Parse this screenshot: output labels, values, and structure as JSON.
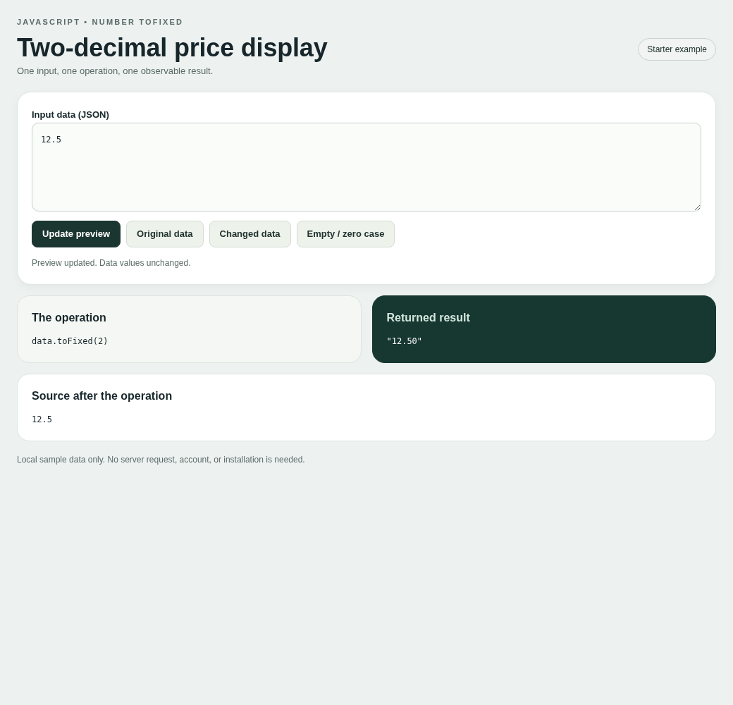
{
  "header": {
    "eyebrow": "JAVASCRIPT • NUMBER TOFIXED",
    "title": "Two-decimal price display",
    "subtitle": "One input, one operation, one observable result.",
    "badge": "Starter example"
  },
  "input_panel": {
    "label": "Input data (JSON)",
    "value": "12.5",
    "buttons": [
      {
        "label": "Update preview",
        "kind": "primary"
      },
      {
        "label": "Original data",
        "kind": "secondary"
      },
      {
        "label": "Changed data",
        "kind": "secondary"
      },
      {
        "label": "Empty / zero case",
        "kind": "secondary"
      }
    ],
    "status": "Preview updated. Data values unchanged."
  },
  "cards": [
    {
      "kind": "operation",
      "title": "The operation",
      "code": "data.toFixed(2)"
    },
    {
      "kind": "result",
      "title": "Returned result",
      "code": "\"12.50\""
    },
    {
      "kind": "source",
      "title": "Source after the operation",
      "code": "12.5"
    }
  ],
  "footer": "Local sample data only. No server request, account, or installation is needed."
}
